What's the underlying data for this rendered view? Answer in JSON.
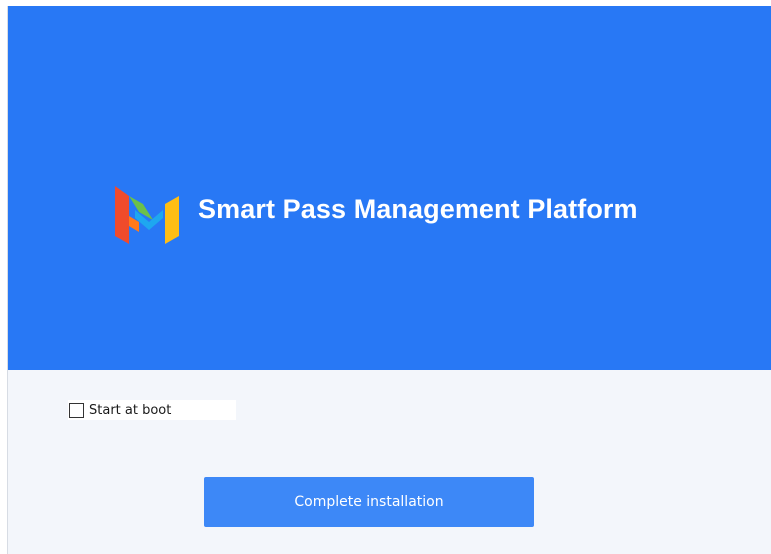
{
  "banner": {
    "background_color": "#2878f5",
    "logo_icon": "m-logo-icon",
    "title": "Smart Pass Management Platform"
  },
  "options": {
    "start_at_boot_label": "Start at boot",
    "start_at_boot_checked": false
  },
  "actions": {
    "complete_label": "Complete installation",
    "button_color": "#3d88f7"
  }
}
